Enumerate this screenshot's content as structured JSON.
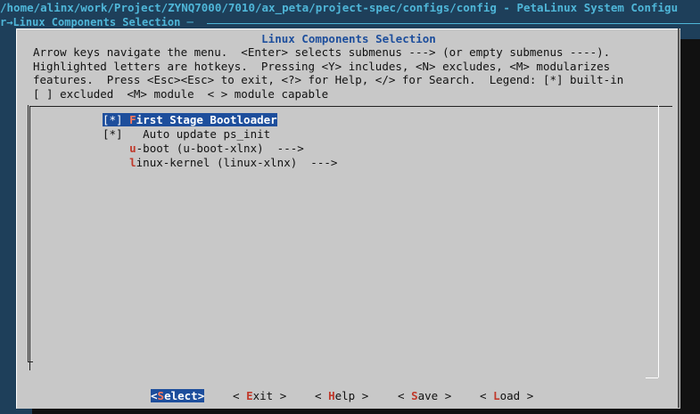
{
  "window": {
    "title": "/home/alinx/work/Project/ZYNQ7000/7010/ax_peta/project-spec/configs/config - PetaLinux System Configu",
    "breadcrumb": "r→Linux Components Selection ─"
  },
  "dialog": {
    "title": "Linux Components Selection",
    "help_lines": [
      "Arrow keys navigate the menu.  <Enter> selects submenus ---> (or empty submenus ----).",
      "Highlighted letters are hotkeys.  Pressing <Y> includes, <N> excludes, <M> modularizes",
      "features.  Press <Esc><Esc> to exit, <?> for Help, </> for Search.  Legend: [*] built-in",
      "[ ] excluded  <M> module  < > module capable"
    ]
  },
  "menu": {
    "items": [
      {
        "prefix": "[*] ",
        "hotkey": "F",
        "rest": "irst Stage Bootloader",
        "selected": true
      },
      {
        "prefix": "[*]   ",
        "hotkey": "",
        "rest": "Auto update ps_init",
        "selected": false
      },
      {
        "prefix": "    ",
        "hotkey": "u",
        "rest": "-boot (u-boot-xlnx)  --->",
        "selected": false
      },
      {
        "prefix": "    ",
        "hotkey": "l",
        "rest": "inux-kernel (linux-xlnx)  --->",
        "selected": false
      }
    ]
  },
  "buttons": {
    "select": {
      "open": "<",
      "hotkey": "S",
      "rest": "elect",
      "close": ">"
    },
    "exit": {
      "open": "< ",
      "hotkey": "E",
      "rest": "xit",
      "close": " >"
    },
    "help": {
      "open": "< ",
      "hotkey": "H",
      "rest": "elp",
      "close": " >"
    },
    "save": {
      "open": "< ",
      "hotkey": "S",
      "rest": "ave",
      "close": " >"
    },
    "load": {
      "open": "< ",
      "hotkey": "L",
      "rest": "oad",
      "close": " >"
    }
  },
  "colors": {
    "terminal_bg": "#1e3f5a",
    "dialog_bg": "#c8c8c8",
    "title_blue": "#1d4e9c",
    "hotkey_red": "#c0392b",
    "header_cyan": "#4fb6d8"
  }
}
